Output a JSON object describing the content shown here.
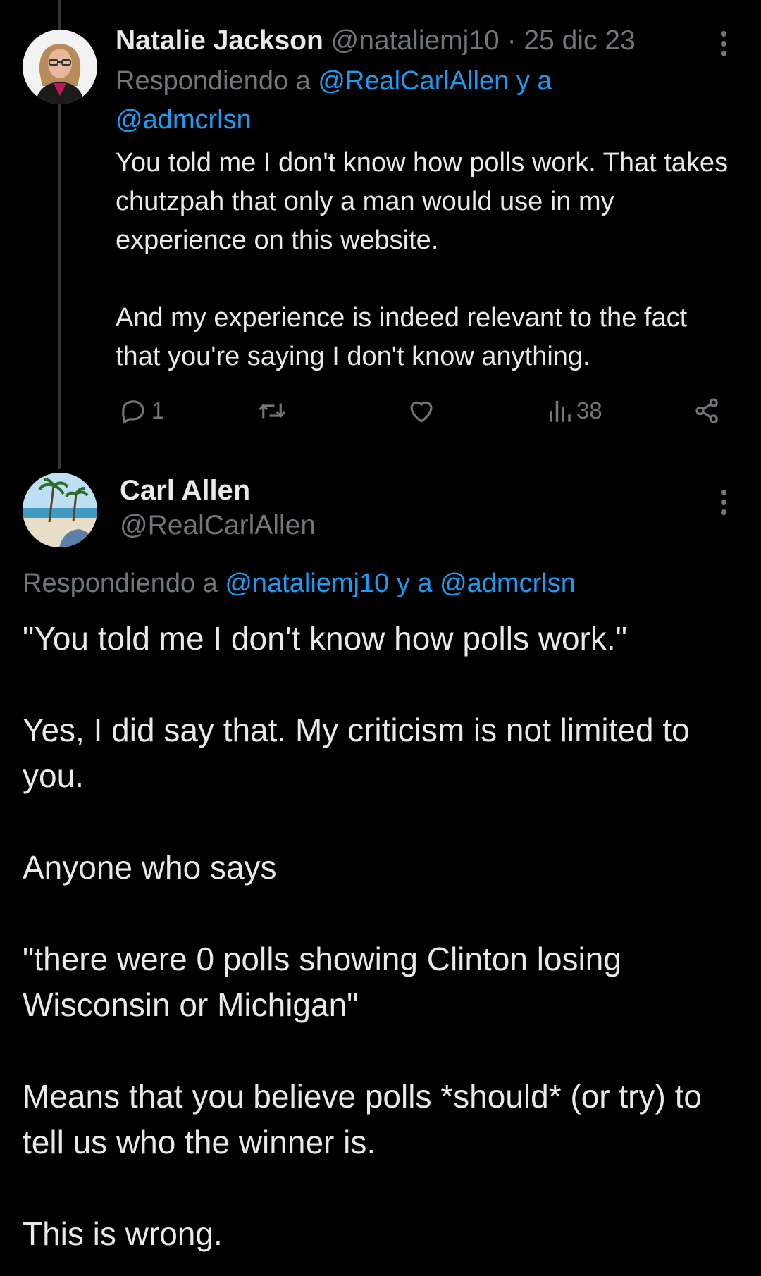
{
  "tweet1": {
    "author_name": "Natalie Jackson",
    "handle": "@nataliemj10",
    "separator": "·",
    "date": "25 dic 23",
    "replying_prefix": "Respondiendo a",
    "replying_to_1": "@RealCarlAllen",
    "replying_conj": "y a",
    "replying_to_2": "@admcrlsn",
    "paragraphs": [
      "You told me I don't know how polls work. That takes chutzpah that only a man would use in my experience on this website.",
      "And my experience is indeed relevant to the fact that you're saying I don't know anything."
    ],
    "replies_count": "1",
    "views_count": "38",
    "icons": {
      "reply": "reply-icon",
      "retweet": "retweet-icon",
      "like": "like-icon",
      "views": "views-icon",
      "share": "share-icon",
      "more": "more-options-icon"
    }
  },
  "tweet2": {
    "author_name": "Carl Allen",
    "handle": "@RealCarlAllen",
    "replying_prefix": "Respondiendo a",
    "replying_to_1": "@nataliemj10",
    "replying_conj": "y a",
    "replying_to_2": "@admcrlsn",
    "paragraphs": [
      "\"You told me I don't know how polls work.\"",
      "Yes, I did say that. My criticism is not limited to you.",
      "Anyone who says",
      "\"there were 0 polls showing Clinton losing Wisconsin or Michigan\"",
      "Means that you believe polls *should* (or try) to tell us who the winner is.",
      "This is wrong."
    ]
  },
  "colors": {
    "background": "#000000",
    "primary_text": "#e7e9ea",
    "secondary_text": "#71767b",
    "link": "#1d9bf0",
    "thread_line": "#333639"
  }
}
